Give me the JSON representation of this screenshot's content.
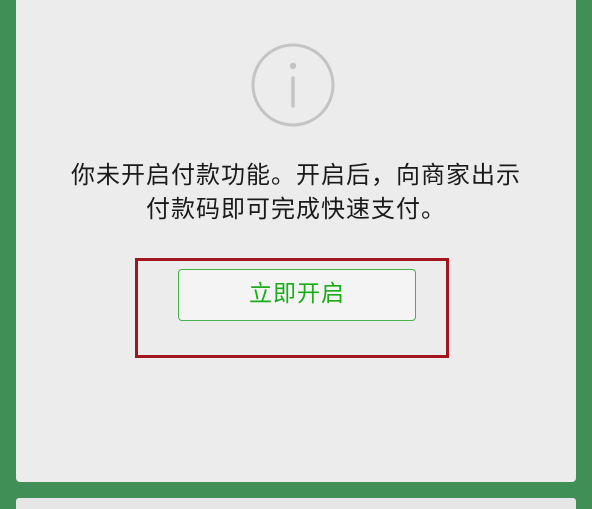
{
  "payment_notice": {
    "icon": "info-circle-icon",
    "message_line1": "你未开启付款功能。开启后，向商家出示",
    "message_line2": "付款码即可完成快速支付。",
    "enable_button_label": "立即开启"
  },
  "colors": {
    "background_green": "#3f8f56",
    "card": "#ececec",
    "button_green": "#1aad19",
    "highlight_red": "#a3141e",
    "icon_gray": "#c4c4c4"
  }
}
